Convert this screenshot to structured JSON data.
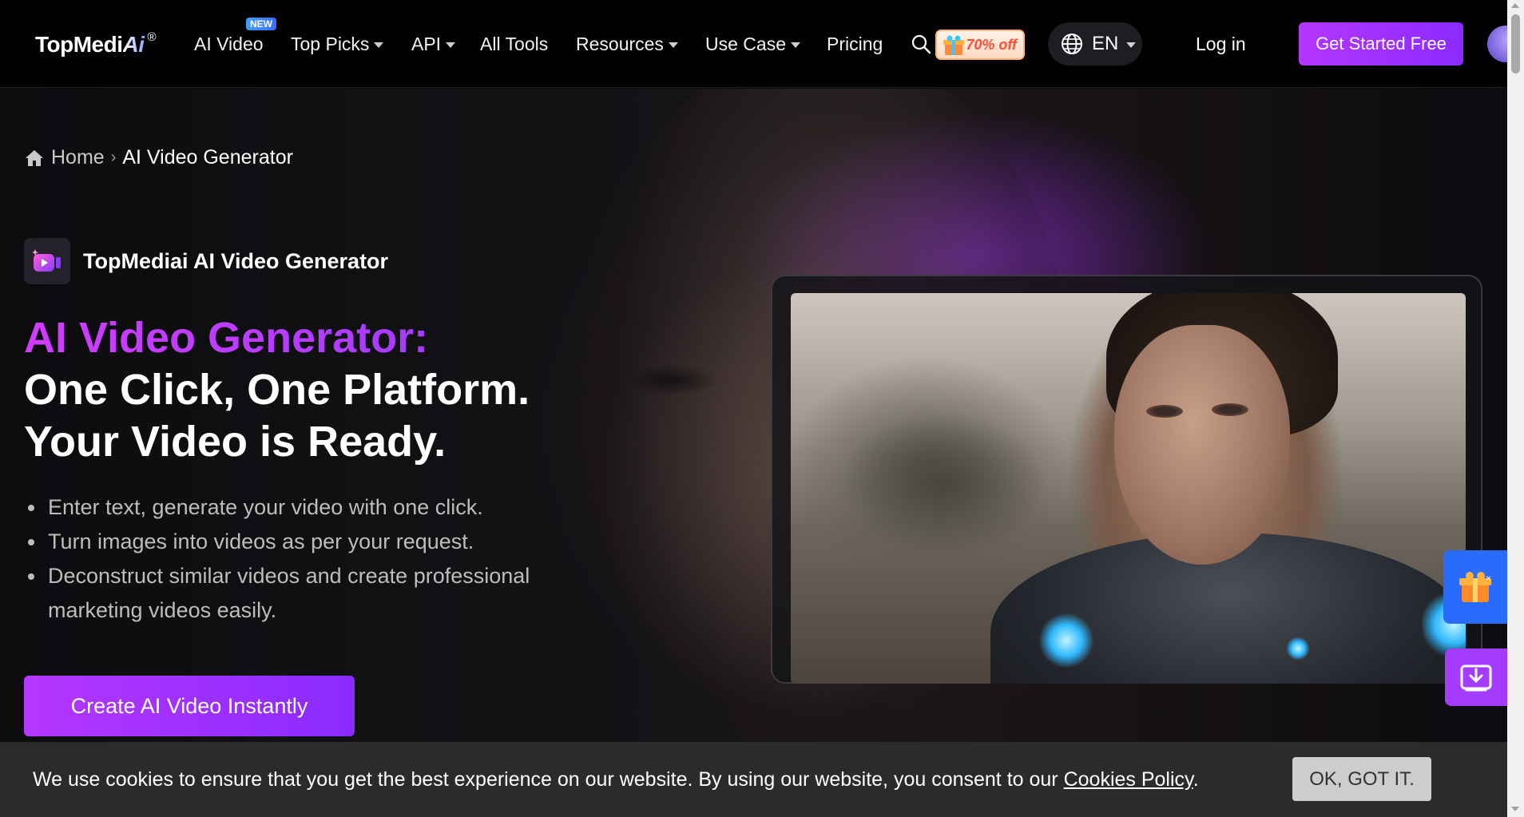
{
  "nav": {
    "logo_text": "TopMedi",
    "logo_ai": "Ai",
    "logo_reg": "®",
    "items": [
      {
        "label": "AI Video",
        "badge": "NEW",
        "dropdown": false
      },
      {
        "label": "Top Picks",
        "dropdown": true
      },
      {
        "label": "API",
        "dropdown": true
      },
      {
        "label": "All Tools",
        "dropdown": false
      },
      {
        "label": "Resources",
        "dropdown": true
      },
      {
        "label": "Use Case",
        "dropdown": true
      },
      {
        "label": "Pricing",
        "dropdown": false
      }
    ],
    "promo": "70% off",
    "language": "EN",
    "login": "Log in",
    "cta": "Get Started Free",
    "icons": {
      "search": "search-icon",
      "globe": "globe-icon",
      "promo_gift": "gift-icon"
    }
  },
  "breadcrumb": {
    "home": "Home",
    "separator": "›",
    "current": "AI Video Generator"
  },
  "hero": {
    "product_name": "TopMediai AI Video Generator",
    "title_line1": "AI Video Generator:",
    "title_line2": "One Click, One Platform.",
    "title_line3": "Your Video is Ready.",
    "bullets": [
      "Enter text, generate your video with one click.",
      "Turn images into videos as per your request.",
      "Deconstruct similar videos and create professional marketing videos easily."
    ],
    "cta": "Create AI Video Instantly"
  },
  "floating": {
    "gift": "gift-icon",
    "close": "×",
    "download": "download-icon"
  },
  "cookie": {
    "text": "We use cookies to ensure that you get the best experience on our website. By using our website, you consent to our ",
    "link": "Cookies Policy",
    "suffix": ".",
    "button": "OK, GOT IT."
  },
  "colors": {
    "accent_start": "#b536ff",
    "accent_end": "#8a2bff",
    "badge_blue": "#3b6cff",
    "float_gift_bg": "#2a6bff",
    "cookie_bg": "#2b2b2e"
  }
}
